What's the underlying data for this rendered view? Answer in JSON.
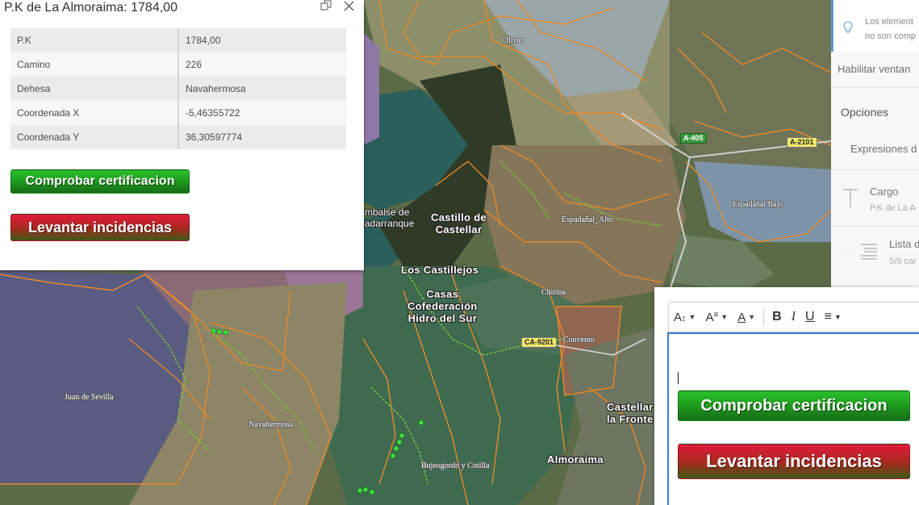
{
  "popup": {
    "title": "P.K de La Almoraima: 1784,00",
    "maximize_icon": "maximize-icon",
    "close_icon": "close-icon",
    "attributes": [
      {
        "key": "P.K",
        "value": "1784,00"
      },
      {
        "key": "Camino",
        "value": "226"
      },
      {
        "key": "Dehesa",
        "value": "Navahermosa"
      },
      {
        "key": "Coordenada X",
        "value": "-5,46355722"
      },
      {
        "key": "Coordenada Y",
        "value": "36,30597774"
      }
    ],
    "buttons": {
      "check": "Comprobar certificacion",
      "incidents": "Levantar incidencias"
    }
  },
  "map": {
    "places": {
      "olivar": "Olivar",
      "embalse_1": "mbalse de",
      "embalse_2": "adarranque",
      "castillo_1": "Castillo de",
      "castillo_2": "Castellar",
      "espadanal_alto": "Espadañal_Alto",
      "espadanal_bajo": "Espadañal Bajo",
      "castillejos": "Los Castillejos",
      "casas_1": "Casas",
      "casas_2": "Cofederación",
      "casas_3": "Hidro del Sur",
      "chirina": "Chirina",
      "convento": "Convento",
      "juan_sevilla": "Juan de Sevilla",
      "navahermosa": "Navahermosa",
      "bujeogordo": "Bujeogordo y Cotilla",
      "castellar_1": "Castellar",
      "castellar_2": "la Fronte",
      "almoraima": "Almoraima"
    },
    "roads": {
      "a405": "A-405",
      "a2101": "A-2101",
      "ca9201": "CA-9201"
    }
  },
  "side_panel": {
    "hint_icon": "lightbulb-icon",
    "hint_line1": "Los element",
    "hint_line2": "no son comp",
    "enable_windows": "Habilitar ventan",
    "options": "Opciones",
    "expressions": "Expresiones d",
    "title_item": {
      "icon": "text-title-icon",
      "label": "Cargo",
      "sub": "P.K de La A"
    },
    "list_item": {
      "icon": "list-icon",
      "label": "Lista d",
      "sub": "5/9 car"
    }
  },
  "editor": {
    "toolbar": [
      {
        "name": "font-size-icon",
        "glyph": "A↕"
      },
      {
        "name": "text-style-icon",
        "glyph": "A⁼"
      },
      {
        "name": "font-color-icon",
        "glyph": "A"
      },
      {
        "name": "bold-icon",
        "glyph": "B"
      },
      {
        "name": "italic-icon",
        "glyph": "I"
      },
      {
        "name": "underline-icon",
        "glyph": "U"
      },
      {
        "name": "align-icon",
        "glyph": "≡"
      }
    ],
    "buttons": {
      "check": "Comprobar certificacion",
      "incidents": "Levantar incidencias"
    }
  },
  "colors": {
    "green_button": "#1f9a1f",
    "red_button": "#c0203a",
    "focus_border": "#3a7bd5",
    "orange_lines": "#e8892a"
  }
}
